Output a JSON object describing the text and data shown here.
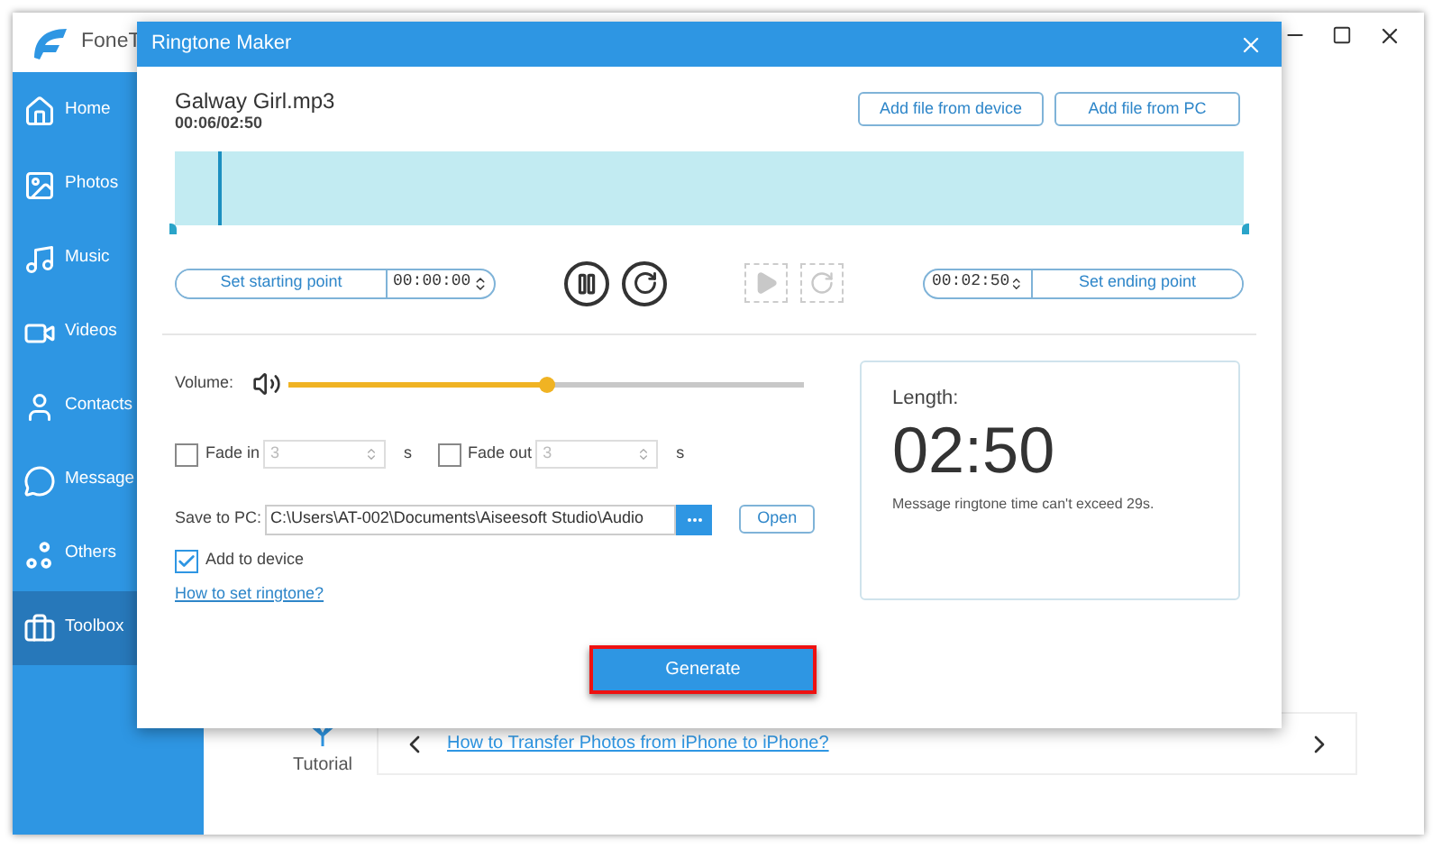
{
  "app": {
    "logo_text": "FoneT",
    "sidebar": [
      {
        "kind": "home",
        "label": "Home",
        "selected": false
      },
      {
        "kind": "photos",
        "label": "Photos",
        "selected": false
      },
      {
        "kind": "music",
        "label": "Music",
        "selected": false
      },
      {
        "kind": "videos",
        "label": "Videos",
        "selected": false
      },
      {
        "kind": "contacts",
        "label": "Contacts",
        "selected": false
      },
      {
        "kind": "messages",
        "label": "Message",
        "selected": false
      },
      {
        "kind": "others",
        "label": "Others",
        "selected": false
      },
      {
        "kind": "toolbox",
        "label": "Toolbox",
        "selected": true
      }
    ],
    "tutorial": {
      "label": "Tutorial",
      "link": "How to Transfer Photos from iPhone to iPhone?"
    }
  },
  "dialog": {
    "title": "Ringtone Maker",
    "file_name": "Galway Girl.mp3",
    "position": "00:06/02:50",
    "add_buttons": [
      "Add file from device",
      "Add file from PC"
    ],
    "waveform": {
      "level": 0.04
    },
    "start": {
      "button": "Set starting point",
      "time": "00:00:00"
    },
    "controls": [
      {
        "kind": "pause",
        "disabled": false
      },
      {
        "kind": "replay",
        "disabled": false
      },
      {
        "kind": "play",
        "disabled": true
      },
      {
        "kind": "replay",
        "disabled": true
      }
    ],
    "end": {
      "time": "00:02:50",
      "button": "Set ending point"
    },
    "volume": {
      "label": "Volume:",
      "level": 0.5
    },
    "fades": [
      {
        "label": "Fade in",
        "checked": false,
        "value": "3",
        "unit": "s"
      },
      {
        "label": "Fade out",
        "checked": false,
        "value": "3",
        "unit": "s"
      }
    ],
    "save": {
      "label": "Save to PC:",
      "path": "C:\\Users\\AT-002\\Documents\\Aiseesoft Studio\\Audio",
      "open": "Open"
    },
    "add_to_device": {
      "label": "Add to device",
      "checked": true
    },
    "help_link": "How to set ringtone?",
    "length": {
      "label": "Length:",
      "value": "02:50",
      "note": "Message ringtone time can't exceed 29s."
    },
    "generate": "Generate"
  }
}
